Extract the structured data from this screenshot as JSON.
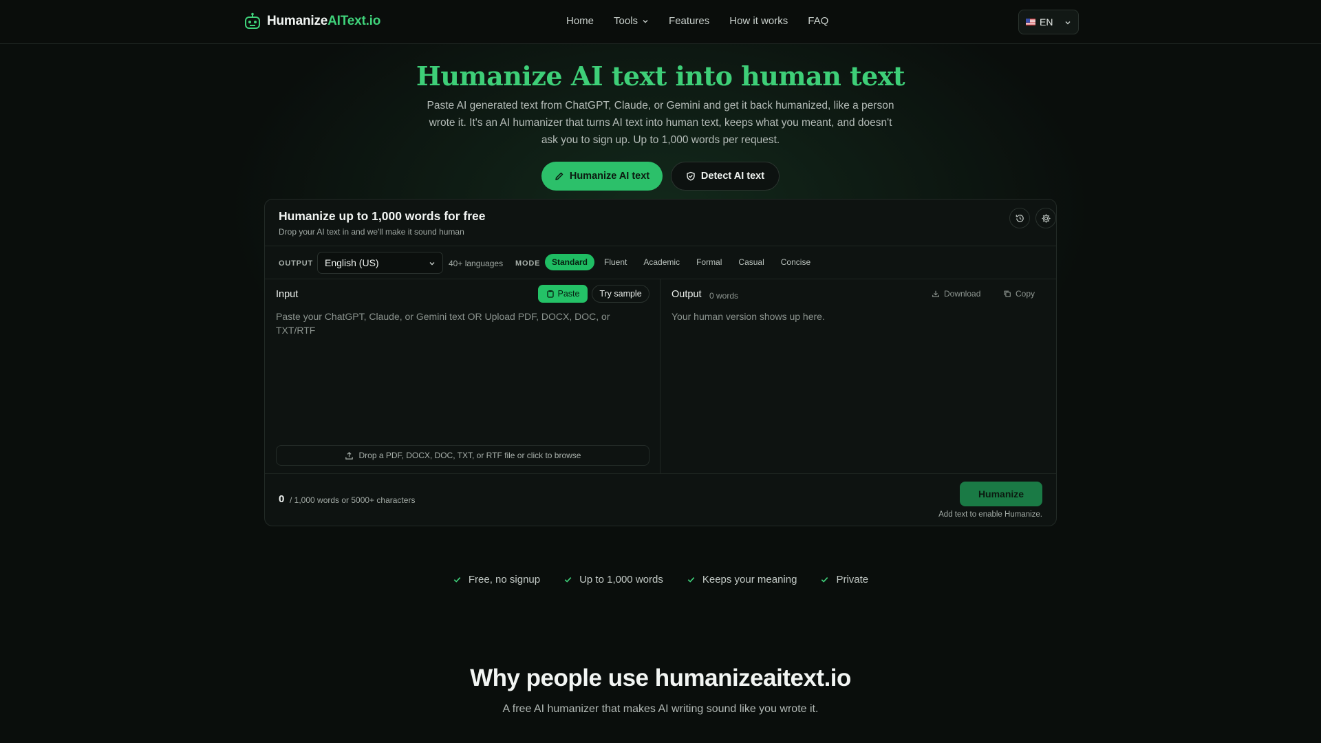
{
  "brand": {
    "name_main": "Humanize",
    "name_accent": "AIText.io",
    "accent_color": "#3fd27a"
  },
  "nav": {
    "items": [
      "Home",
      "Tools",
      "Features",
      "How it works",
      "FAQ"
    ],
    "language": "EN"
  },
  "hero": {
    "title": "Humanize AI text into human text",
    "subtitle": "Paste AI generated text from ChatGPT, Claude, or Gemini and get it back humanized, like a person wrote it. It's an AI humanizer that turns AI text into human text, keeps what you meant, and doesn't ask you to sign up. Up to 1,000 words per request.",
    "primary_cta": "Humanize AI text",
    "secondary_cta": "Detect AI text"
  },
  "card": {
    "title": "Humanize up to 1,000 words for free",
    "description": "Drop your AI text in and we'll make it sound human",
    "output_label": "OUTPUT",
    "output_language": "English (US)",
    "languages_note": "40+ languages",
    "mode_label": "MODE",
    "modes": [
      "Standard",
      "Fluent",
      "Academic",
      "Formal",
      "Casual",
      "Concise"
    ],
    "active_mode": "Standard",
    "input": {
      "label": "Input",
      "paste": "Paste",
      "try_sample": "Try sample",
      "placeholder": "Paste your ChatGPT, Claude, or Gemini text OR Upload PDF, DOCX, DOC, or TXT/RTF",
      "dropzone": "Drop a PDF, DOCX, DOC, TXT, or RTF file or click to browse"
    },
    "output": {
      "label": "Output",
      "word_count": "0 words",
      "download": "Download",
      "copy": "Copy",
      "placeholder": "Your human version shows up here."
    },
    "footer": {
      "count": "0",
      "limit": "/ 1,000 words or 5000+ characters",
      "humanize": "Humanize",
      "hint": "Add text to enable Humanize."
    }
  },
  "badges": [
    "Free, no signup",
    "Up to 1,000 words",
    "Keeps your meaning",
    "Private"
  ],
  "why": {
    "title": "Why people use humanizeaitext.io",
    "subtitle": "A free AI humanizer that makes AI writing sound like you wrote it."
  }
}
